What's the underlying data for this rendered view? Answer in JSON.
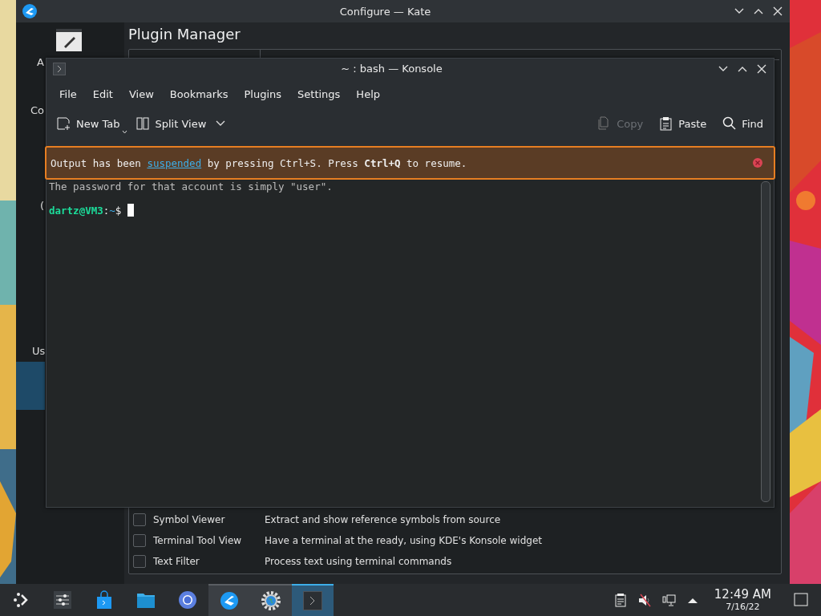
{
  "kate_window": {
    "title": "Configure — Kate",
    "sidebar": {
      "items": [
        {
          "label": "A",
          "selected": false
        },
        {
          "label": "Co",
          "selected": false
        },
        {
          "label": "(",
          "selected": false
        },
        {
          "label": "Us",
          "selected": false
        },
        {
          "selected": true
        }
      ]
    },
    "page_title": "Plugin Manager",
    "plugins": [
      {
        "name": "Symbol Viewer",
        "description": "Extract and show reference symbols from source",
        "checked": false
      },
      {
        "name": "Terminal Tool View",
        "description": "Have a terminal at the ready, using KDE's Konsole widget",
        "checked": false
      },
      {
        "name": "Text Filter",
        "description": "Process text using terminal commands",
        "checked": false
      }
    ]
  },
  "konsole_window": {
    "title": "~ : bash — Konsole",
    "menu": [
      "File",
      "Edit",
      "View",
      "Bookmarks",
      "Plugins",
      "Settings",
      "Help"
    ],
    "toolbar_left": [
      {
        "label": "New Tab",
        "disabled": false
      },
      {
        "label": "Split View",
        "disabled": false
      }
    ],
    "toolbar_right": [
      {
        "label": "Copy",
        "disabled": true
      },
      {
        "label": "Paste",
        "disabled": false
      },
      {
        "label": "Find",
        "disabled": false
      }
    ],
    "banner": {
      "before": "Output has been ",
      "link": "suspended",
      "after": " by pressing Ctrl+S. Press **Ctrl+Q** to resume."
    },
    "terminal": {
      "lines": [
        {
          "kind": "output",
          "text": "The password for that account is simply \"user\"."
        },
        {
          "kind": "prompt",
          "user": "dartz@VM3",
          "sep": ":",
          "path": "~",
          "symbol": "$"
        }
      ]
    }
  },
  "taskbar": {
    "items": [
      {
        "open": false,
        "selected": false
      },
      {
        "open": false,
        "selected": false
      },
      {
        "open": false,
        "selected": false
      },
      {
        "open": false,
        "selected": false
      },
      {
        "open": false,
        "selected": false
      },
      {
        "open": true,
        "selected": false
      },
      {
        "open": true,
        "selected": false
      },
      {
        "open": true,
        "selected": true
      }
    ],
    "clock": {
      "time": "12:49 AM",
      "date": "7/16/22"
    }
  }
}
